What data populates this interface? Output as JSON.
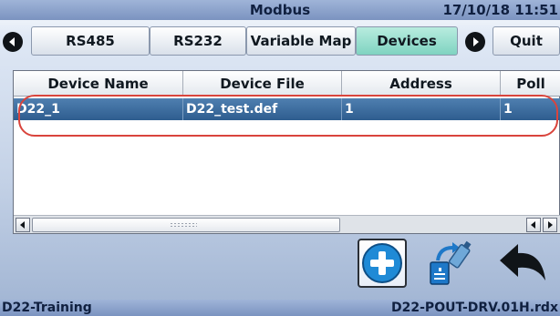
{
  "titlebar": {
    "title": "Modbus",
    "datetime": "17/10/18 11:51"
  },
  "tabs": [
    {
      "label": "RS485",
      "active": false
    },
    {
      "label": "RS232",
      "active": false
    },
    {
      "label": "Variable Map",
      "active": false
    },
    {
      "label": "Devices",
      "active": true
    },
    {
      "label": "Quit",
      "active": false
    }
  ],
  "icons": {
    "nav_back": "arrow-left-circle-icon",
    "nav_forward": "arrow-right-circle-icon",
    "add": "plus-icon",
    "transfer": "usb-transfer-icon",
    "undo": "back-arrow-icon"
  },
  "table": {
    "columns": [
      "Device Name",
      "Device File",
      "Address",
      "Poll"
    ],
    "rows": [
      [
        "D22_1",
        "D22_test.def",
        "1",
        "1"
      ]
    ]
  },
  "statusbar": {
    "project": "D22-Training",
    "file": "D22-POUT-DRV.01H.rdx"
  },
  "colors": {
    "active_tab": "#7fd3c1",
    "selected_row": "#3a6a9c",
    "highlight_outline": "#d9443c",
    "add_icon": "#1f8ad6"
  }
}
